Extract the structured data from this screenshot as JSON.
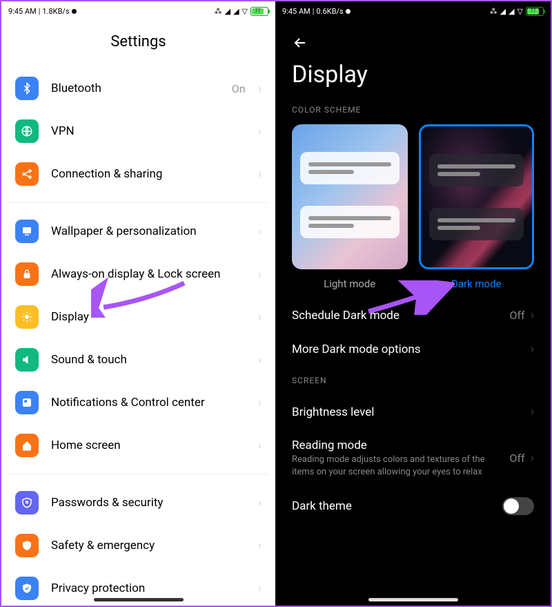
{
  "status": {
    "time": "9:45 AM",
    "speed1": "1.8KB/s",
    "speed2": "0.6KB/s",
    "batt": "77"
  },
  "left": {
    "title": "Settings",
    "items": [
      {
        "label": "Bluetooth",
        "value": "On",
        "color": "#3b82f6",
        "icon": "bluetooth"
      },
      {
        "label": "VPN",
        "color": "#10b981",
        "icon": "globe"
      },
      {
        "label": "Connection & sharing",
        "color": "#f97316",
        "icon": "share"
      }
    ],
    "items2": [
      {
        "label": "Wallpaper & personalization",
        "color": "#3b82f6",
        "icon": "wallpaper"
      },
      {
        "label": "Always-on display & Lock screen",
        "color": "#f97316",
        "icon": "lock"
      },
      {
        "label": "Display",
        "color": "#fbbf24",
        "icon": "sun"
      },
      {
        "label": "Sound & touch",
        "color": "#10b981",
        "icon": "sound"
      },
      {
        "label": "Notifications & Control center",
        "color": "#3b82f6",
        "icon": "notif"
      },
      {
        "label": "Home screen",
        "color": "#f97316",
        "icon": "home"
      }
    ],
    "items3": [
      {
        "label": "Passwords & security",
        "color": "#6366f1",
        "icon": "shield"
      },
      {
        "label": "Safety & emergency",
        "color": "#f97316",
        "icon": "emerg"
      },
      {
        "label": "Privacy protection",
        "color": "#3b82f6",
        "icon": "privacy"
      }
    ]
  },
  "right": {
    "title": "Display",
    "section1": "COLOR SCHEME",
    "light": "Light mode",
    "dark": "Dark mode",
    "schedule": {
      "label": "Schedule Dark mode",
      "value": "Off"
    },
    "more": "More Dark mode options",
    "section2": "SCREEN",
    "brightness": "Brightness level",
    "reading": {
      "label": "Reading mode",
      "sub": "Reading mode adjusts colors and textures of the items on your screen allowing your eyes to relax",
      "value": "Off"
    },
    "darktheme": "Dark theme"
  }
}
